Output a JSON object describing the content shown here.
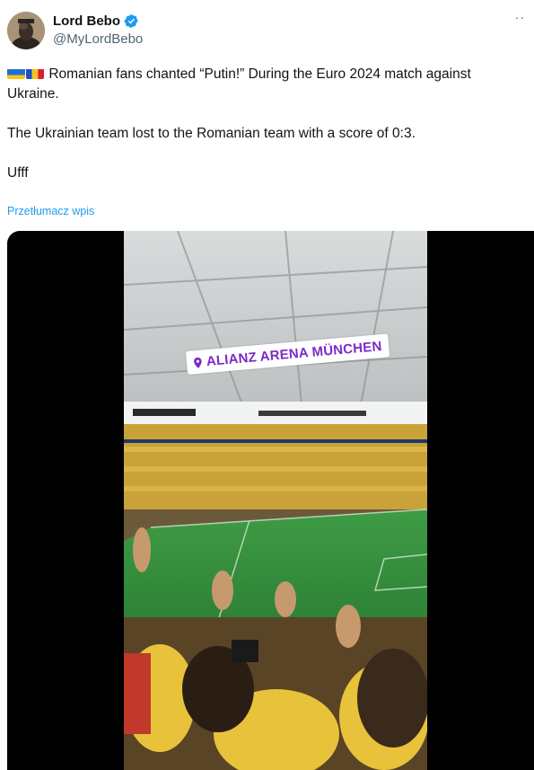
{
  "author": {
    "name": "Lord Bebo",
    "handle": "@MyLordBebo",
    "verified_color": "#1d9bf0"
  },
  "tweet": {
    "line1": "Romanian fans chanted “Putin!” During the Euro 2024 match against Ukraine.",
    "line2": "The Ukrainian team lost to the Romanian team with a score of 0:3.",
    "line3": "Ufff",
    "flags": [
      "ukraine-flag",
      "romania-flag"
    ]
  },
  "translate_link": "Przetłumacz wpis",
  "more_icon": "more-icon",
  "media": {
    "location_label": "ALIANZ ARENA MÜNCHEN",
    "accent_color": "#7b2cc9"
  }
}
